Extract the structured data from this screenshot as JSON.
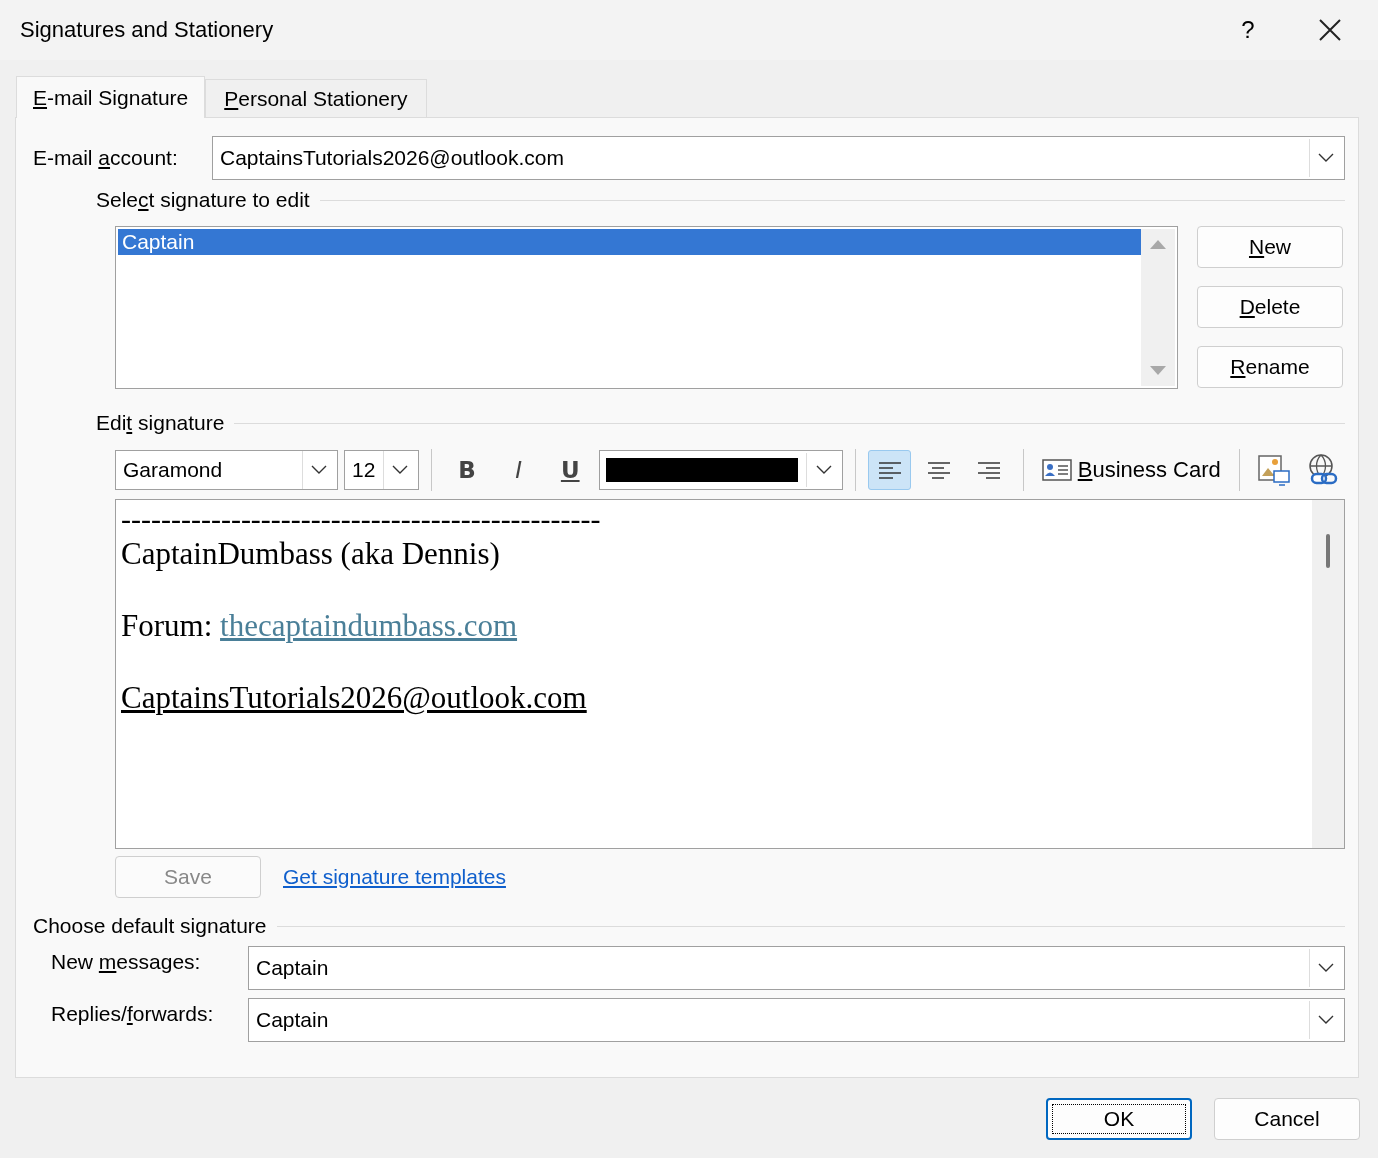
{
  "window": {
    "title": "Signatures and Stationery",
    "help": "?"
  },
  "tabs": [
    {
      "label": {
        "key": "E",
        "post": "-mail Signature"
      },
      "selected": true
    },
    {
      "label": {
        "key": "P",
        "post": "ersonal Stationery"
      },
      "selected": false
    }
  ],
  "account": {
    "label": {
      "pre": "E-mail ",
      "key": "a",
      "post": "ccount:"
    },
    "value": "CaptainsTutorials2026@outlook.com"
  },
  "select_signature": {
    "title": {
      "pre": "Sele",
      "key": "c",
      "post": "t signature to edit"
    },
    "signatures": [
      {
        "name": "Captain",
        "selected": true
      }
    ],
    "buttons": [
      {
        "label": {
          "key": "N",
          "post": "ew"
        }
      },
      {
        "label": {
          "key": "D",
          "post": "elete"
        }
      },
      {
        "label": {
          "key": "R",
          "post": "ename"
        }
      }
    ]
  },
  "edit_signature": {
    "title": {
      "pre": "Edi",
      "key": "t",
      "post": " signature"
    },
    "toolbar": {
      "font": "Garamond",
      "size": "12",
      "format_buttons": [
        {
          "kind": "bold",
          "label": "B"
        },
        {
          "kind": "italic",
          "label": "I"
        },
        {
          "kind": "underline",
          "label": "U"
        }
      ],
      "alignment": [
        {
          "kind": "left",
          "selected": true
        },
        {
          "kind": "center",
          "selected": false
        },
        {
          "kind": "right",
          "selected": false
        }
      ],
      "business_card": {
        "key": "B",
        "post": "usiness Card"
      }
    },
    "lines": [
      {
        "kind": "rule",
        "text": "------------------------------------------------"
      },
      {
        "kind": "para",
        "segments": [
          {
            "text": "CaptainDumbass (aka Dennis)"
          }
        ]
      },
      {
        "kind": "para",
        "segments": [
          {
            "text": "Forum: "
          },
          {
            "text": "thecaptaindumbass.com",
            "link": true
          }
        ]
      },
      {
        "kind": "para",
        "segments": [
          {
            "text": "CaptainsTutorials2026@outlook.com",
            "underline": true
          }
        ]
      }
    ],
    "save": {
      "label": "Save",
      "disabled": true
    },
    "templates_link": "Get signature templates"
  },
  "default_signature": {
    "title": "Choose default signature",
    "rows": [
      {
        "label": {
          "pre": "New ",
          "key": "m",
          "post": "essages:"
        },
        "value": "Captain"
      },
      {
        "label": {
          "pre": "Replies/",
          "key": "f",
          "post": "orwards:"
        },
        "value": "Captain"
      }
    ]
  },
  "footer_buttons": [
    {
      "label": "OK",
      "default": true
    },
    {
      "label": "Cancel",
      "default": false
    }
  ]
}
